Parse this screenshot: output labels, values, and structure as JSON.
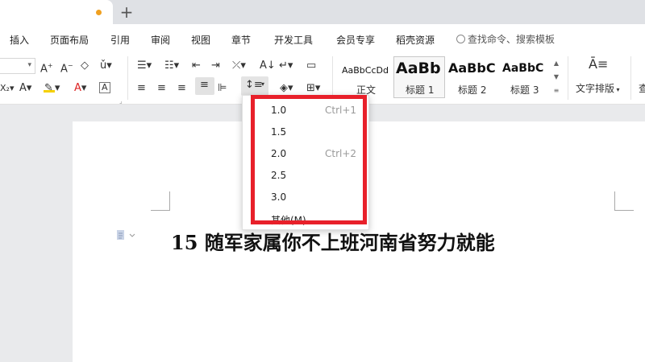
{
  "tabbar": {
    "add_label": "+"
  },
  "menubar": {
    "items": [
      "插入",
      "页面布局",
      "引用",
      "审阅",
      "视图",
      "章节",
      "开发工具",
      "会员专享",
      "稻壳资源"
    ],
    "search_placeholder": "查找命令、搜索模板"
  },
  "ribbon": {
    "styles": [
      {
        "sample": "AaBbCcDd",
        "name": "正文"
      },
      {
        "sample": "AaBb",
        "name": "标题 1"
      },
      {
        "sample": "AaBbC",
        "name": "标题 2"
      },
      {
        "sample": "AaBbC",
        "name": "标题 3"
      }
    ],
    "text_layout_label": "文字排版",
    "cut_off_label": "查"
  },
  "line_spacing_menu": {
    "options": [
      {
        "label": "1.0",
        "shortcut": "Ctrl+1"
      },
      {
        "label": "1.5",
        "shortcut": ""
      },
      {
        "label": "2.0",
        "shortcut": "Ctrl+2"
      },
      {
        "label": "2.5",
        "shortcut": ""
      },
      {
        "label": "3.0",
        "shortcut": ""
      },
      {
        "label": "其他(M)...",
        "shortcut": ""
      }
    ]
  },
  "document": {
    "title": "15 随军家属你不上班河南省努力就能"
  },
  "colors": {
    "accent_orange": "#f0a020",
    "highlight_red": "#e8202a",
    "font_color_red": "#d22",
    "highlight_yellow": "#f5d000"
  }
}
